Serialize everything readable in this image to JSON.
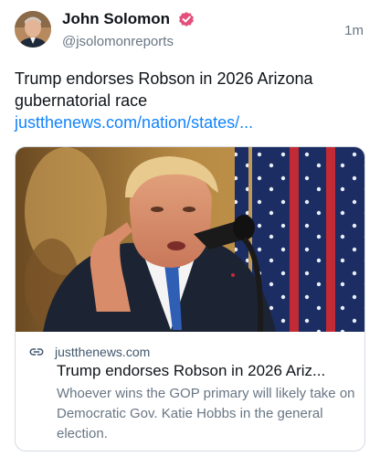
{
  "author": {
    "display_name": "John Solomon",
    "handle": "@jsolomonreports",
    "verified_icon": "verified-badge-icon",
    "verified_color": "#e34f7a"
  },
  "post": {
    "timestamp": "1m",
    "text": "Trump endorses Robson in 2026 Arizona gubernatorial race",
    "link_text": "justthenews.com/nation/states/..."
  },
  "card": {
    "image_alt": "Photo of Donald Trump speaking at a microphone in front of an American flag",
    "domain": "justthenews.com",
    "domain_icon": "link-icon",
    "title": "Trump endorses Robson in 2026 Ariz...",
    "description": "Whoever wins the GOP primary will likely take on Democratic Gov. Katie Hobbs in the general election."
  },
  "colors": {
    "link": "#1083fe",
    "secondary_text": "#687684",
    "border": "#d4dbe2"
  }
}
